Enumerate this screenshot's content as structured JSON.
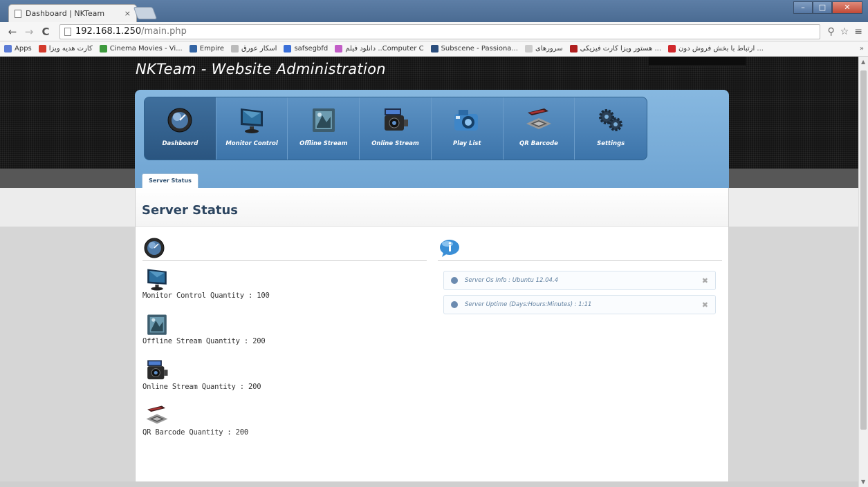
{
  "browser": {
    "tab_title": "Dashboard | NKTeam",
    "tab_close": "×",
    "url_host": "192.168.1.250",
    "url_path": "/main.php",
    "back": "←",
    "forward": "→",
    "reload": "C",
    "bookmarks": [
      {
        "label": "Apps",
        "color": "#5b7bd5"
      },
      {
        "label": "کارت هدیه ویزا",
        "color": "#d33a2c"
      },
      {
        "label": "Cinema Movies - Vi...",
        "color": "#3e9a3e"
      },
      {
        "label": "Empire",
        "color": "#3465a4"
      },
      {
        "label": "اسکار عورق",
        "color": "#bbbbbb"
      },
      {
        "label": "safsegbfd",
        "color": "#3a6fd8"
      },
      {
        "label": "دانلود فیلم ..Computer C",
        "color": "#c25dc7"
      },
      {
        "label": "Subscene - Passiona...",
        "color": "#2b4e7d"
      },
      {
        "label": "سرورهای",
        "color": "#cccccc"
      },
      {
        "label": "هستور ویزا کارت فیزیکی ...",
        "color": "#b01f1f"
      },
      {
        "label": "ارتباط با بخش فروش دون ...",
        "color": "#d0282c"
      }
    ],
    "bookmarks_more": "»"
  },
  "site": {
    "title": "NKTeam - Website Administration"
  },
  "nav": {
    "items": [
      {
        "label": "Dashboard",
        "icon": "gauge-icon"
      },
      {
        "label": "Monitor Control",
        "icon": "monitor-icon"
      },
      {
        "label": "Offline Stream",
        "icon": "film-icon"
      },
      {
        "label": "Online Stream",
        "icon": "camcorder-icon"
      },
      {
        "label": "Play List",
        "icon": "camera-icon"
      },
      {
        "label": "QR Barcode",
        "icon": "barcode-icon"
      },
      {
        "label": "Settings",
        "icon": "gears-icon"
      }
    ]
  },
  "content": {
    "tab": "Server Status",
    "title": "Server Status",
    "stats": [
      {
        "text": "Monitor Control Quantity : 100",
        "icon": "monitor-icon"
      },
      {
        "text": "Offline Stream Quantity : 200",
        "icon": "film-icon"
      },
      {
        "text": "Online Stream Quantity : 200",
        "icon": "camcorder-icon"
      },
      {
        "text": "QR Barcode Quantity : 200",
        "icon": "barcode-icon"
      }
    ],
    "info": [
      {
        "text": "Server Os Info : Ubuntu 12.04.4"
      },
      {
        "text": "Server Uptime (Days:Hours:Minutes) : 1:11"
      }
    ]
  },
  "colors": {
    "nav_panel": "#7aaed9",
    "header_bg": "#141414",
    "title_text": "#2c4560"
  }
}
